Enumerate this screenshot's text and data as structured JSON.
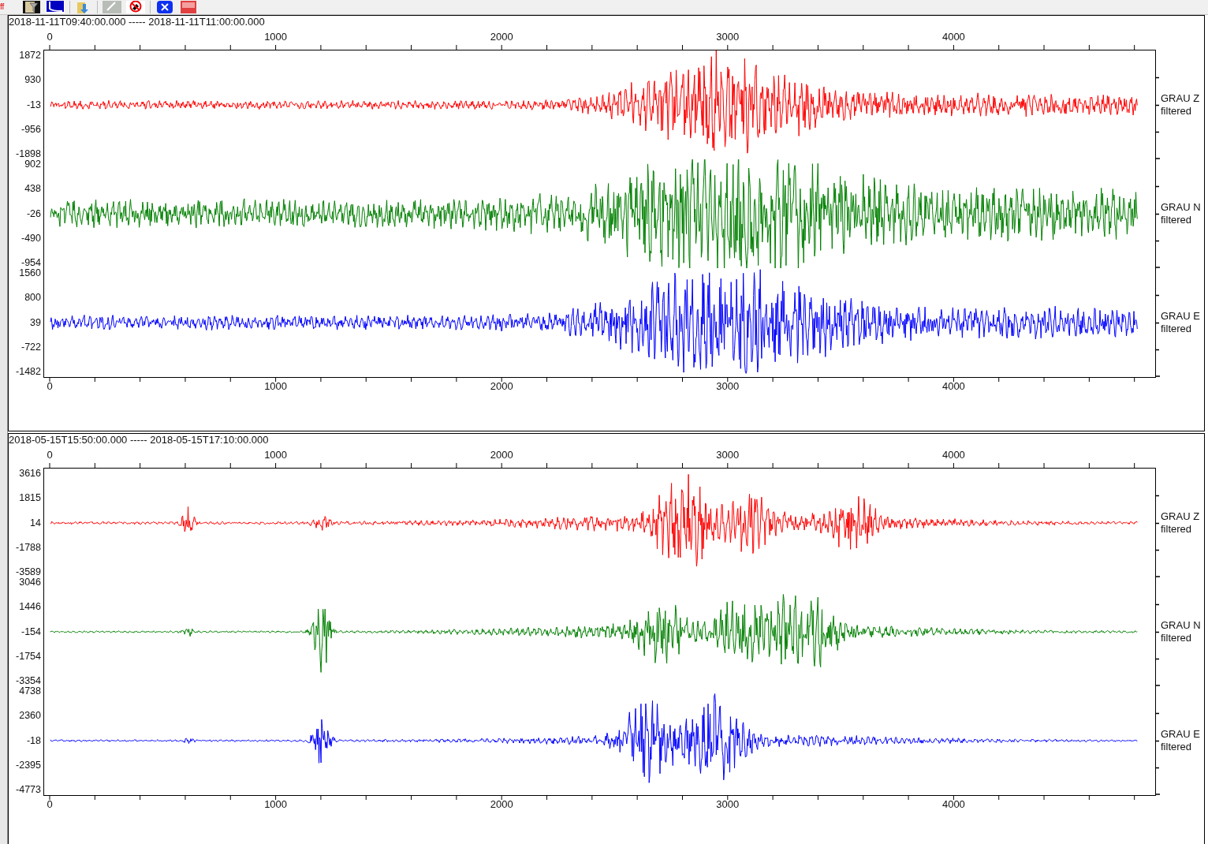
{
  "toolbar": {
    "cut_label": "ff"
  },
  "panels": [
    {
      "title": "2018-11-11T09:40:00.000 ----- 2018-11-11T11:00:00.000",
      "top_x_ticks": [
        "0",
        "1000",
        "2000",
        "3000",
        "4000"
      ],
      "bottom_x_ticks": [
        "0",
        "1000",
        "2000",
        "3000",
        "4000"
      ],
      "traces": [
        {
          "y_ticks": [
            "1872",
            "930",
            "-13",
            "-956",
            "-1898"
          ],
          "station": "GRAU Z",
          "note": "filtered",
          "color": "#ff0000"
        },
        {
          "y_ticks": [
            "902",
            "438",
            "-26",
            "-490",
            "-954"
          ],
          "station": "GRAU N",
          "note": "filtered",
          "color": "#008000"
        },
        {
          "y_ticks": [
            "1560",
            "800",
            "39",
            "-722",
            "-1482"
          ],
          "station": "GRAU E",
          "note": "filtered",
          "color": "#0000ff"
        }
      ]
    },
    {
      "title": "2018-05-15T15:50:00.000 ----- 2018-05-15T17:10:00.000",
      "top_x_ticks": [
        "0",
        "1000",
        "2000",
        "3000",
        "4000"
      ],
      "bottom_x_ticks": [
        "0",
        "1000",
        "2000",
        "3000",
        "4000"
      ],
      "traces": [
        {
          "y_ticks": [
            "3616",
            "1815",
            "14",
            "-1788",
            "-3589"
          ],
          "station": "GRAU Z",
          "note": "filtered",
          "color": "#ff0000"
        },
        {
          "y_ticks": [
            "3046",
            "1446",
            "-154",
            "-1754",
            "-3354"
          ],
          "station": "GRAU N",
          "note": "filtered",
          "color": "#008000"
        },
        {
          "y_ticks": [
            "4738",
            "2360",
            "-18",
            "-2395",
            "-4773"
          ],
          "station": "GRAU E",
          "note": "filtered",
          "color": "#0000ff"
        }
      ]
    }
  ]
}
